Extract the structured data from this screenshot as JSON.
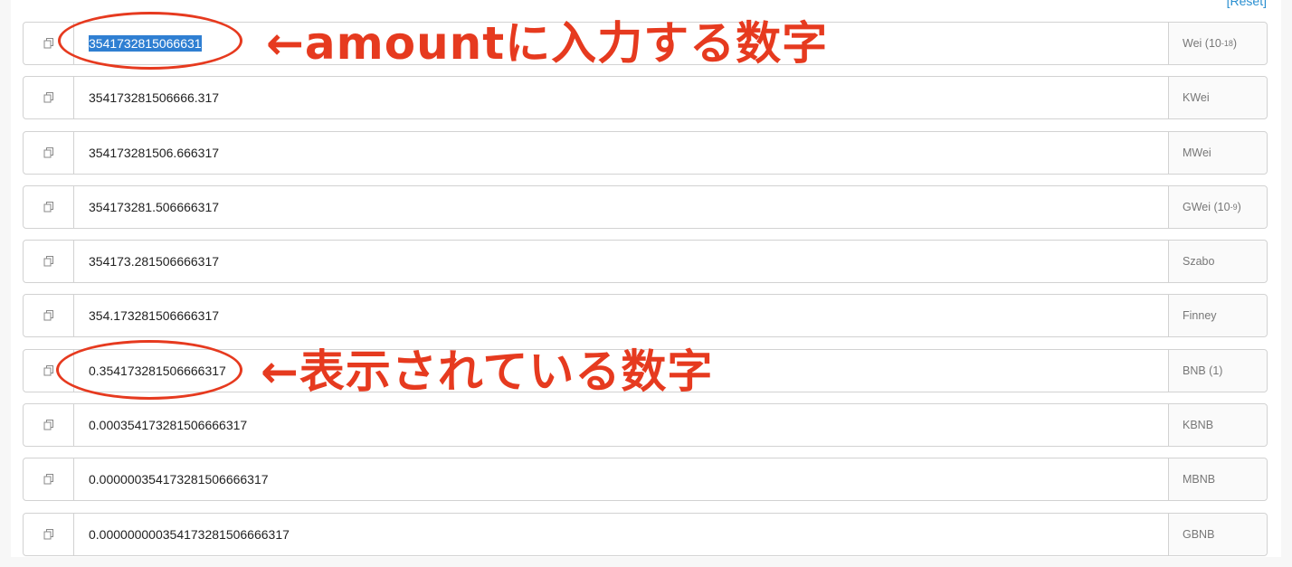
{
  "reset_label": "[Reset]",
  "rows": [
    {
      "value": "3541732815066631",
      "unit_base": "Wei",
      "unit_exp": "-18",
      "unit_suffix": ")"
    },
    {
      "value": "354173281506666.317",
      "unit_base": "KWei",
      "unit_exp": "",
      "unit_suffix": ""
    },
    {
      "value": "354173281506.666317",
      "unit_base": "MWei",
      "unit_exp": "",
      "unit_suffix": ""
    },
    {
      "value": "354173281.506666317",
      "unit_base": "GWei",
      "unit_exp": "-9",
      "unit_suffix": ")"
    },
    {
      "value": "354173.281506666317",
      "unit_base": "Szabo",
      "unit_exp": "",
      "unit_suffix": ""
    },
    {
      "value": "354.173281506666317",
      "unit_base": "Finney",
      "unit_exp": "",
      "unit_suffix": ""
    },
    {
      "value": "0.354173281506666317",
      "unit_base": "BNB (1)",
      "unit_exp": "",
      "unit_suffix": ""
    },
    {
      "value": "0.000354173281506666317",
      "unit_base": "KBNB",
      "unit_exp": "",
      "unit_suffix": ""
    },
    {
      "value": "0.000000354173281506666317",
      "unit_base": "MBNB",
      "unit_exp": "",
      "unit_suffix": ""
    },
    {
      "value": "0.000000000354173281506666317",
      "unit_base": "GBNB",
      "unit_exp": "",
      "unit_suffix": ""
    }
  ],
  "annotations": {
    "top": "←amountに入力する数字",
    "bottom": "←表示されている数字"
  },
  "colors": {
    "annotation": "#e63a1f",
    "selection": "#2f7fd2",
    "link": "#2a8fd0"
  },
  "icons": {
    "copy": "copy-icon"
  }
}
